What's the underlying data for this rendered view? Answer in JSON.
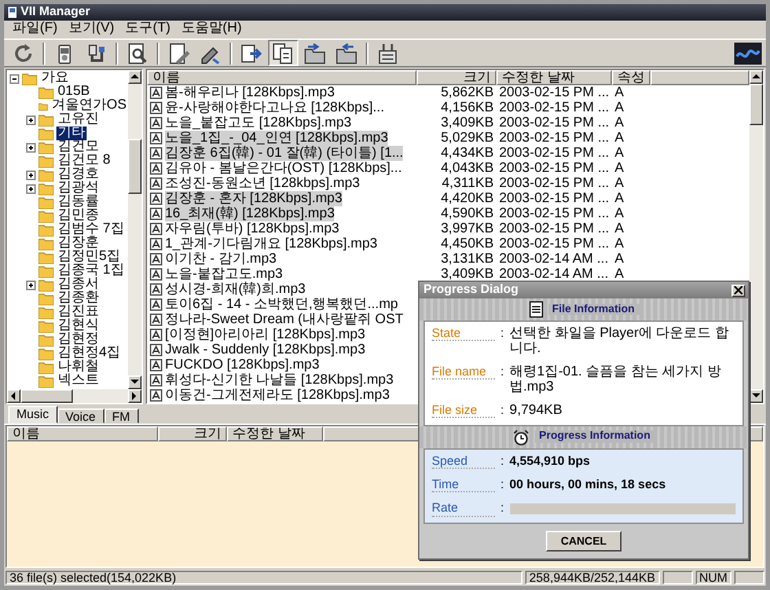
{
  "window": {
    "title": "VII Manager"
  },
  "menu": [
    {
      "label": "파일(F)"
    },
    {
      "label": "보기(V)"
    },
    {
      "label": "도구(T)"
    },
    {
      "label": "도움말(H)"
    }
  ],
  "tree": {
    "items": [
      {
        "label": "가요",
        "expandable": true,
        "expanded": true,
        "selected": false,
        "children": [
          {
            "label": "015B",
            "expandable": false,
            "selected": false
          },
          {
            "label": "겨울연가OS",
            "expandable": false,
            "selected": false
          },
          {
            "label": "고유진",
            "expandable": true,
            "selected": false
          },
          {
            "label": "기타",
            "expandable": false,
            "selected": true
          },
          {
            "label": "김건모",
            "expandable": true,
            "selected": false
          },
          {
            "label": "김건모 8",
            "expandable": false,
            "selected": false
          },
          {
            "label": "김경호",
            "expandable": true,
            "selected": false
          },
          {
            "label": "김광석",
            "expandable": true,
            "selected": false
          },
          {
            "label": "김동률",
            "expandable": false,
            "selected": false
          },
          {
            "label": "김민종",
            "expandable": false,
            "selected": false
          },
          {
            "label": "김범수 7집",
            "expandable": false,
            "selected": false
          },
          {
            "label": "김장훈",
            "expandable": false,
            "selected": false
          },
          {
            "label": "김정민5집",
            "expandable": false,
            "selected": false
          },
          {
            "label": "김종국 1집",
            "expandable": false,
            "selected": false
          },
          {
            "label": "김종서",
            "expandable": true,
            "selected": false
          },
          {
            "label": "김종환",
            "expandable": false,
            "selected": false
          },
          {
            "label": "김진표",
            "expandable": false,
            "selected": false
          },
          {
            "label": "김현식",
            "expandable": false,
            "selected": false
          },
          {
            "label": "김현정",
            "expandable": false,
            "selected": false
          },
          {
            "label": "김현정4집",
            "expandable": false,
            "selected": false
          },
          {
            "label": "나휘철",
            "expandable": false,
            "selected": false
          },
          {
            "label": "넥스트",
            "expandable": false,
            "selected": false
          }
        ]
      }
    ]
  },
  "file_list": {
    "columns": [
      "이름",
      "크기",
      "수정한 날짜",
      "속성"
    ],
    "rows": [
      {
        "name": "봄-해우리나 [128Kbps].mp3",
        "size": "5,862KB",
        "modified": "2003-02-15 PM ...",
        "attr": "A",
        "selected": false
      },
      {
        "name": "윤-사랑해야한다고나요 [128Kbps]...",
        "size": "4,156KB",
        "modified": "2003-02-15 PM ...",
        "attr": "A",
        "selected": false
      },
      {
        "name": "노을_붙잡고도 [128Kbps].mp3",
        "size": "3,409KB",
        "modified": "2003-02-15 PM ...",
        "attr": "A",
        "selected": false
      },
      {
        "name": "노을_1집_-_04_인연 [128Kbps].mp3",
        "size": "5,029KB",
        "modified": "2003-02-15 PM ...",
        "attr": "A",
        "selected": true
      },
      {
        "name": "김장훈 6집(韓) - 01 잘(韓) (타이틀) [1...",
        "size": "4,434KB",
        "modified": "2003-02-15 PM ...",
        "attr": "A",
        "selected": true
      },
      {
        "name": "김유아 - 봄날은간다(OST) [128Kbps]...",
        "size": "4,043KB",
        "modified": "2003-02-15 PM ...",
        "attr": "A",
        "selected": false
      },
      {
        "name": "조성진-동원소년 [128kbps].mp3",
        "size": "4,311KB",
        "modified": "2003-02-15 PM ...",
        "attr": "A",
        "selected": false
      },
      {
        "name": "김장훈 - 혼자 [128Kbps].mp3",
        "size": "4,420KB",
        "modified": "2003-02-15 PM ...",
        "attr": "A",
        "selected": true
      },
      {
        "name": "16_최재(韓) [128Kbps].mp3",
        "size": "4,590KB",
        "modified": "2003-02-15 PM ...",
        "attr": "A",
        "selected": true
      },
      {
        "name": "자우림(투바) [128Kbps].mp3",
        "size": "3,997KB",
        "modified": "2003-02-15 PM ...",
        "attr": "A",
        "selected": false
      },
      {
        "name": "1_관계-기다림개요 [128Kbps].mp3",
        "size": "4,450KB",
        "modified": "2003-02-15 PM ...",
        "attr": "A",
        "selected": false
      },
      {
        "name": "이기찬 - 감기.mp3",
        "size": "3,131KB",
        "modified": "2003-02-14 AM ...",
        "attr": "A",
        "selected": false
      },
      {
        "name": "노을-붙잡고도.mp3",
        "size": "3,409KB",
        "modified": "2003-02-14 AM ...",
        "attr": "A",
        "selected": false
      },
      {
        "name": "성시경-희재(韓)희.mp3",
        "selected": false
      },
      {
        "name": "토이6집 - 14 - 소박했던,행복했던...mp",
        "selected": false
      },
      {
        "name": "정나라-Sweet Dream (내사랑팥쥐 OST",
        "selected": false
      },
      {
        "name": "[이정현]아리아리 [128Kbps].mp3",
        "selected": false
      },
      {
        "name": "Jwalk - Suddenly [128Kbps].mp3",
        "selected": false
      },
      {
        "name": "FUCKDO [128Kbps].mp3",
        "selected": false
      },
      {
        "name": "휘성다-신기한 나날들 [128Kbps].mp3",
        "selected": false
      },
      {
        "name": "이동건-그게전제라도 [128Kbps].mp3",
        "selected": false
      }
    ]
  },
  "bottom_tabs": [
    {
      "label": "Music",
      "selected": true
    },
    {
      "label": "Voice",
      "selected": false
    },
    {
      "label": "FM",
      "selected": false
    }
  ],
  "bottom_list": {
    "columns": [
      "이름",
      "크기",
      "수정한 날짜"
    ]
  },
  "status_bar": {
    "selection": "36 file(s) selected(154,022KB)",
    "capacity": "258,944KB/252,144KB",
    "keyboard": "NUM"
  },
  "dialog": {
    "title": "Progress Dialog",
    "file_section": "File Information",
    "file_fields": [
      {
        "label": "State",
        "sep": ":",
        "value": "선택한 화일을 Player에 다운로드 합니다."
      },
      {
        "label": "File name",
        "sep": ":",
        "value": "해령1집-01. 슬픔을 참는 세가지 방법.mp3"
      },
      {
        "label": "File size",
        "sep": ":",
        "value": "9,794KB"
      }
    ],
    "progress_section": "Progress Information",
    "progress_fields": [
      {
        "label": "Speed",
        "sep": ":",
        "kind": "text",
        "value": "4,554,910 bps"
      },
      {
        "label": "Time",
        "sep": ":",
        "kind": "text",
        "value": "00 hours, 00 mins, 18 secs"
      },
      {
        "label": "Rate",
        "sep": ":",
        "kind": "bar",
        "level": 0
      }
    ],
    "cancel": "CANCEL"
  }
}
